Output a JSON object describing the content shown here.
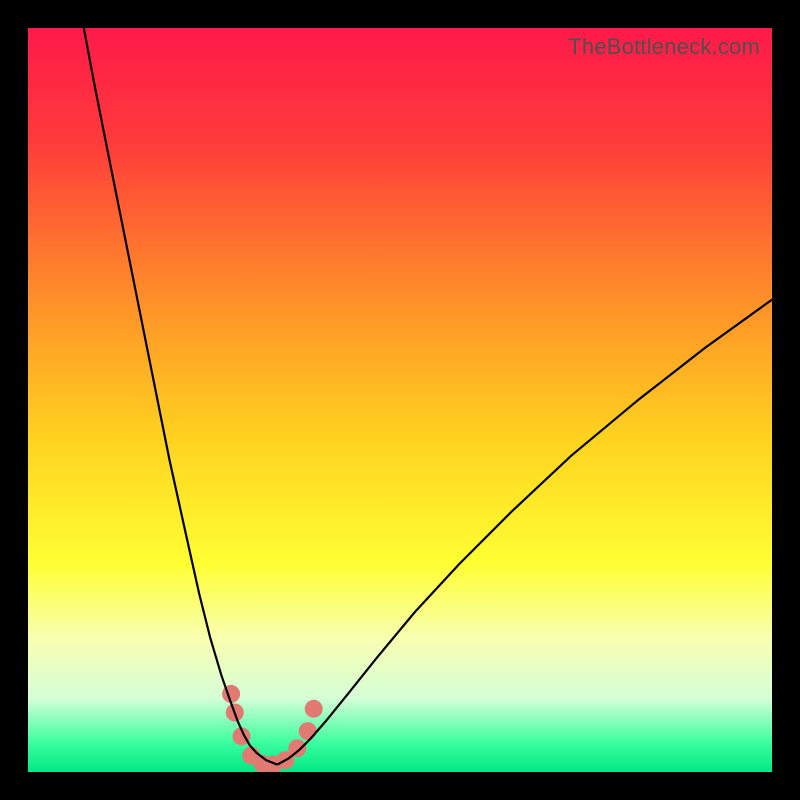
{
  "watermark": "TheBottleneck.com",
  "chart_data": {
    "type": "line",
    "title": "",
    "xlabel": "",
    "ylabel": "",
    "xlim": [
      0,
      100
    ],
    "ylim": [
      0,
      100
    ],
    "grid": false,
    "legend": false,
    "background_gradient_stops": [
      {
        "pos": 0.0,
        "color": "#ff1a4a"
      },
      {
        "pos": 0.15,
        "color": "#ff3a3a"
      },
      {
        "pos": 0.35,
        "color": "#ff8a2a"
      },
      {
        "pos": 0.55,
        "color": "#ffd21f"
      },
      {
        "pos": 0.72,
        "color": "#ffff33"
      },
      {
        "pos": 0.82,
        "color": "#f8ffb0"
      },
      {
        "pos": 0.9,
        "color": "#d6ffd6"
      },
      {
        "pos": 0.96,
        "color": "#3dffa0"
      },
      {
        "pos": 1.0,
        "color": "#00e884"
      }
    ],
    "series": [
      {
        "name": "left-curve",
        "stroke": "#000000",
        "x": [
          7.5,
          9,
          11,
          13,
          15,
          17,
          19,
          21,
          23,
          24.5,
          26,
          27.2,
          28.2,
          29,
          29.8,
          30.7,
          32,
          33.5
        ],
        "y": [
          100,
          92,
          82,
          72,
          62,
          52,
          42,
          33,
          24,
          18,
          13,
          9.5,
          6.8,
          5.0,
          3.6,
          2.6,
          1.6,
          1.0
        ]
      },
      {
        "name": "right-curve",
        "stroke": "#000000",
        "x": [
          33.5,
          35,
          36.5,
          38,
          40,
          43,
          47,
          52,
          58,
          65,
          73,
          82,
          91,
          100
        ],
        "y": [
          1.0,
          1.8,
          3.0,
          4.5,
          6.8,
          10.5,
          15.5,
          21.5,
          28,
          35,
          42.5,
          50,
          57,
          63.5
        ]
      },
      {
        "name": "valley-markers",
        "type": "scatter",
        "marker_color": "#e27a74",
        "x": [
          27.3,
          27.8,
          28.7,
          30.0,
          31.5,
          33.0,
          34.6,
          36.2,
          37.6,
          38.4
        ],
        "y": [
          10.5,
          8.0,
          4.8,
          2.2,
          1.1,
          1.0,
          1.6,
          3.2,
          5.5,
          8.5
        ]
      }
    ]
  }
}
